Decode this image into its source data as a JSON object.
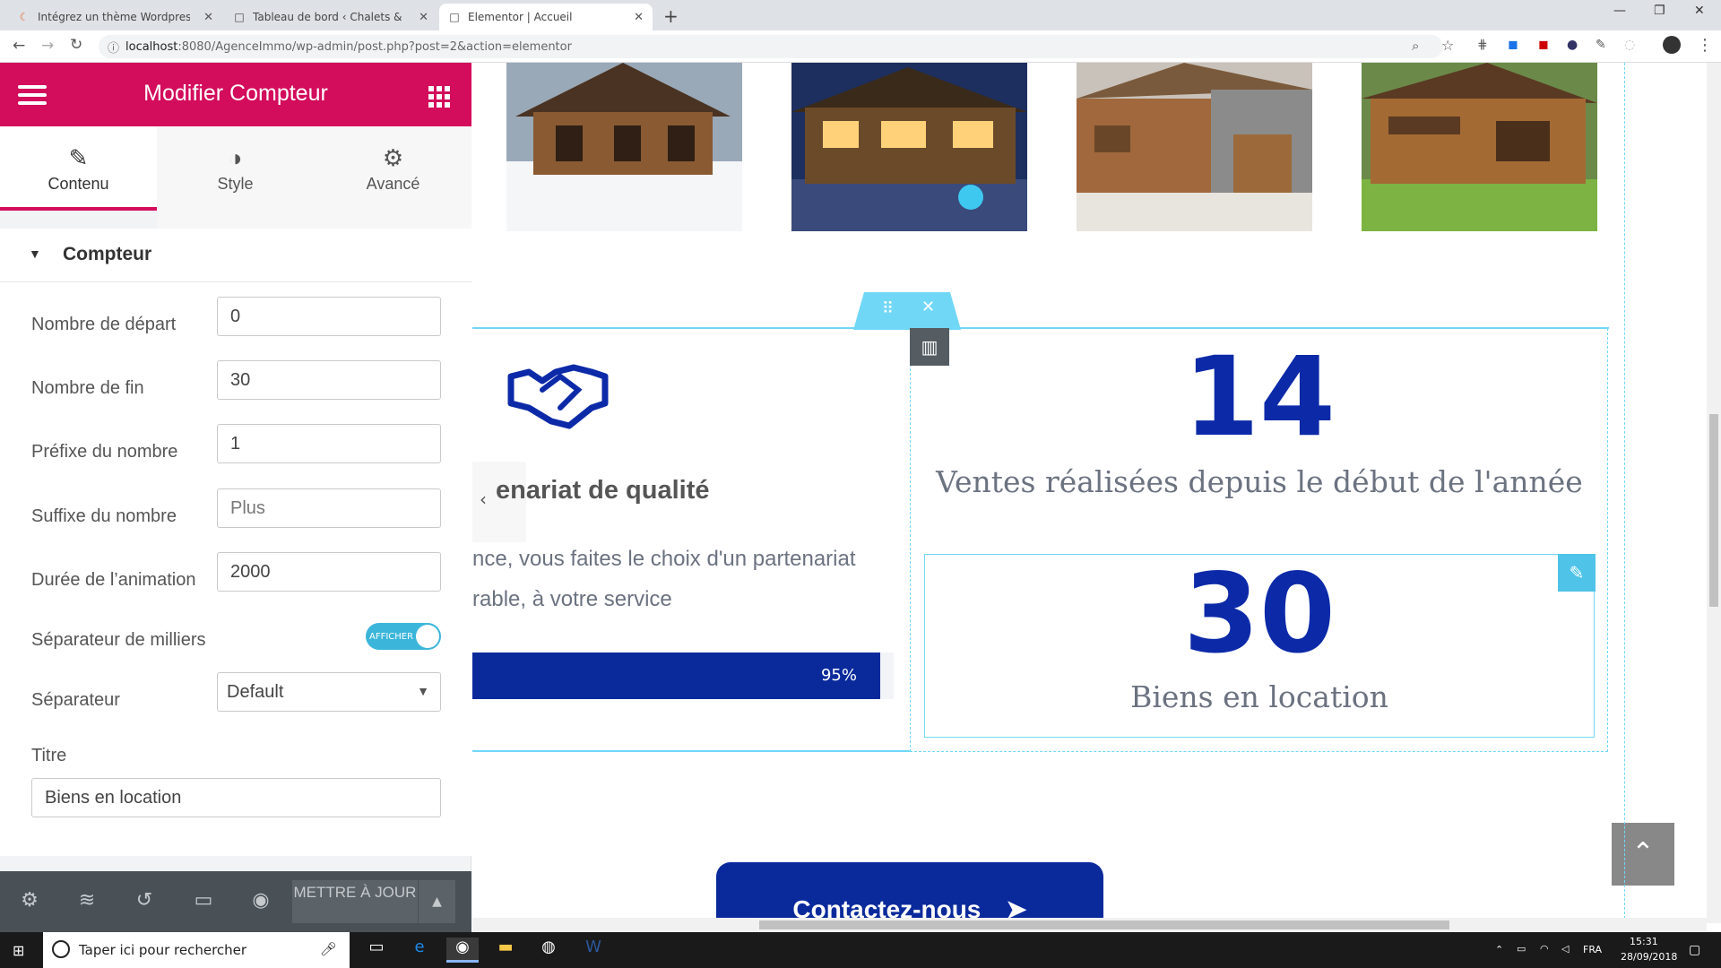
{
  "browser": {
    "tabs": [
      {
        "title": "Intégrez un thème Wordpress pour",
        "icon": "openclassrooms-icon",
        "active": false
      },
      {
        "title": "Tableau de bord ‹ Chalets & Caviar",
        "icon": "document-icon",
        "active": false
      },
      {
        "title": "Elementor | Accueil",
        "icon": "document-icon",
        "active": true
      }
    ],
    "url_host": "localhost",
    "url_rest": ":8080/AgenceImmo/wp-admin/post.php?post=2&action=elementor"
  },
  "panel": {
    "title": "Modifier Compteur",
    "tabs": [
      {
        "label": "Contenu",
        "icon": "pencil-icon"
      },
      {
        "label": "Style",
        "icon": "contrast-icon"
      },
      {
        "label": "Avancé",
        "icon": "gear-icon"
      }
    ],
    "section_title": "Compteur",
    "fields": {
      "start": {
        "label": "Nombre de départ",
        "value": "0"
      },
      "end": {
        "label": "Nombre de fin",
        "value": "30"
      },
      "prefix": {
        "label": "Préfixe du nombre",
        "value": "1"
      },
      "suffix": {
        "label": "Suffixe du nombre",
        "placeholder": "Plus"
      },
      "duration": {
        "label": "Durée de l’animation",
        "value": "2000"
      },
      "thousands": {
        "label": "Séparateur de milliers",
        "toggle_text": "AFFICHER"
      },
      "separator": {
        "label": "Séparateur",
        "value": "Default"
      },
      "title": {
        "label": "Titre",
        "value": "Biens en location"
      }
    },
    "footer": {
      "update_label": "METTRE À JOUR"
    }
  },
  "preview": {
    "partner_heading": "enariat de qualité",
    "partner_text_line1": "nce, vous faites le choix d'un partenariat",
    "partner_text_line2": "rable, à votre service",
    "progress_label": "95%",
    "progress_value": 0.95,
    "counter1_number": "14",
    "counter1_title": "Ventes réalisées depuis le début de l'année",
    "counter2_number": "30",
    "counter2_title": "Biens en location",
    "contact_label": "Contactez-nous"
  },
  "taskbar": {
    "search_placeholder": "Taper ici pour rechercher",
    "lang": "FRA",
    "time": "15:31",
    "date": "28/09/2018"
  },
  "colors": {
    "brand": "#d30c5c",
    "accent": "#0a2a9c",
    "edit": "#4fc3e8"
  }
}
